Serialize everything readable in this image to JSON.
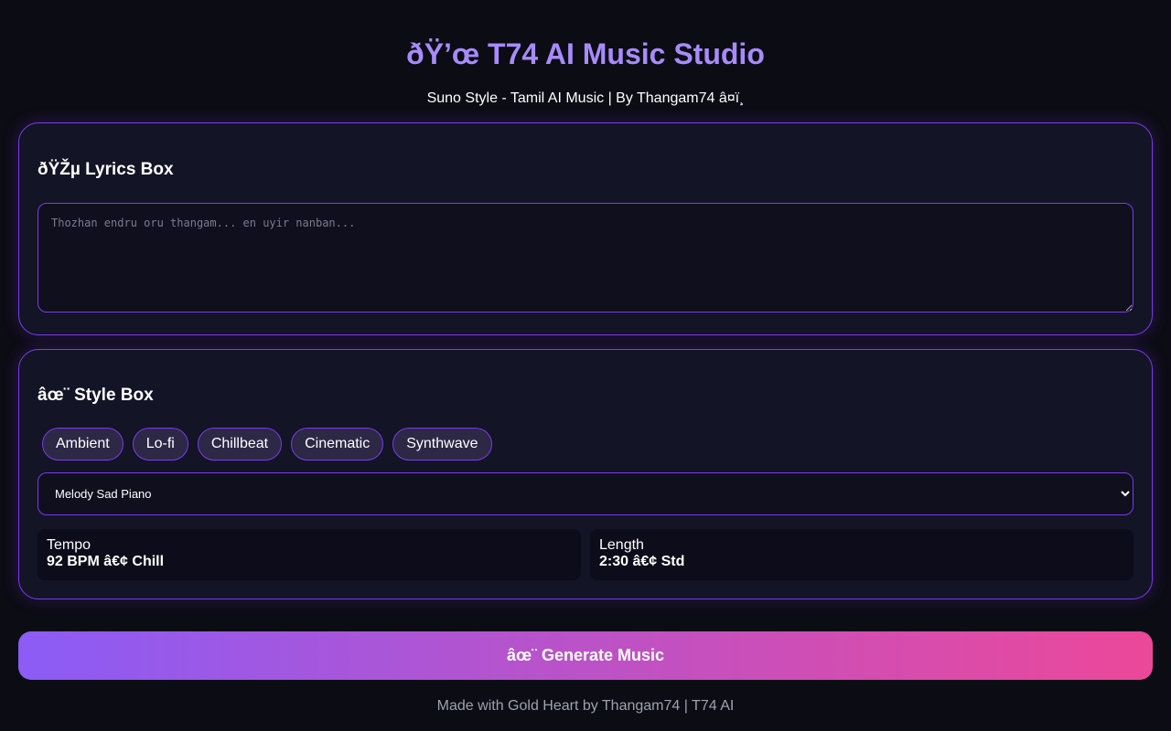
{
  "header": {
    "title": "ðŸ’œ T74 AI Music Studio",
    "subtitle": "Suno Style - Tamil AI Music | By Thangam74 â¤ï¸"
  },
  "lyrics": {
    "title": "ðŸŽµ Lyrics Box",
    "placeholder": "Thozhan endru oru thangam... en uyir nanban...",
    "value": ""
  },
  "style": {
    "title": "âœ¨ Style Box",
    "chips": [
      "Ambient",
      "Lo-fi",
      "Chillbeat",
      "Cinematic",
      "Synthwave"
    ],
    "selected": "Melody Sad Piano",
    "tempo": {
      "label": "Tempo",
      "value": "92 BPM â€¢ Chill"
    },
    "length": {
      "label": "Length",
      "value": "2:30 â€¢ Std"
    }
  },
  "generate": {
    "label": "âœ¨ Generate Music"
  },
  "footer": {
    "text": "Made with Gold Heart by Thangam74 | T74 AI"
  },
  "colors": {
    "background": "#0c0c14",
    "card": "#131426",
    "accent": "#7c3aed",
    "title": "#a78bfa",
    "gradient_start": "#8b5cf6",
    "gradient_end": "#ec4899"
  }
}
